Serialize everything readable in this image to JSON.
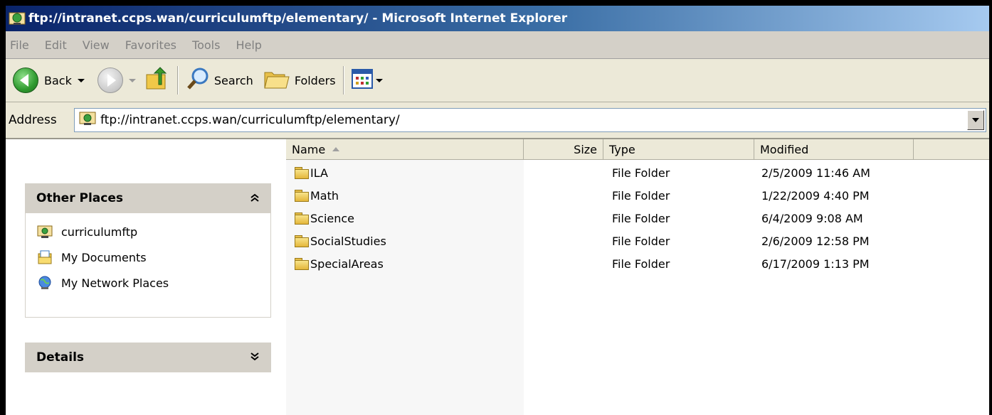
{
  "window": {
    "title": "ftp://intranet.ccps.wan/curriculumftp/elementary/ - Microsoft Internet Explorer"
  },
  "menu": [
    "File",
    "Edit",
    "View",
    "Favorites",
    "Tools",
    "Help"
  ],
  "toolbar": {
    "back_label": "Back",
    "search_label": "Search",
    "folders_label": "Folders"
  },
  "address": {
    "label": "Address",
    "value": "ftp://intranet.ccps.wan/curriculumftp/elementary/"
  },
  "taskpane": {
    "other_places": {
      "title": "Other Places",
      "toggle": "⌃",
      "items": [
        {
          "label": "curriculumftp",
          "icon": "ftp-folder-icon"
        },
        {
          "label": "My Documents",
          "icon": "my-documents-icon"
        },
        {
          "label": "My Network Places",
          "icon": "network-places-icon"
        }
      ]
    },
    "details": {
      "title": "Details",
      "toggle": "⌄"
    }
  },
  "list": {
    "columns": {
      "name": "Name",
      "size": "Size",
      "type": "Type",
      "modified": "Modified"
    },
    "rows": [
      {
        "name": "ILA",
        "size": "",
        "type": "File Folder",
        "modified": "2/5/2009 11:46 AM"
      },
      {
        "name": "Math",
        "size": "",
        "type": "File Folder",
        "modified": "1/22/2009 4:40 PM"
      },
      {
        "name": "Science",
        "size": "",
        "type": "File Folder",
        "modified": "6/4/2009 9:08 AM"
      },
      {
        "name": "SocialStudies",
        "size": "",
        "type": "File Folder",
        "modified": "2/6/2009 12:58 PM"
      },
      {
        "name": "SpecialAreas",
        "size": "",
        "type": "File Folder",
        "modified": "6/17/2009 1:13 PM"
      }
    ]
  }
}
